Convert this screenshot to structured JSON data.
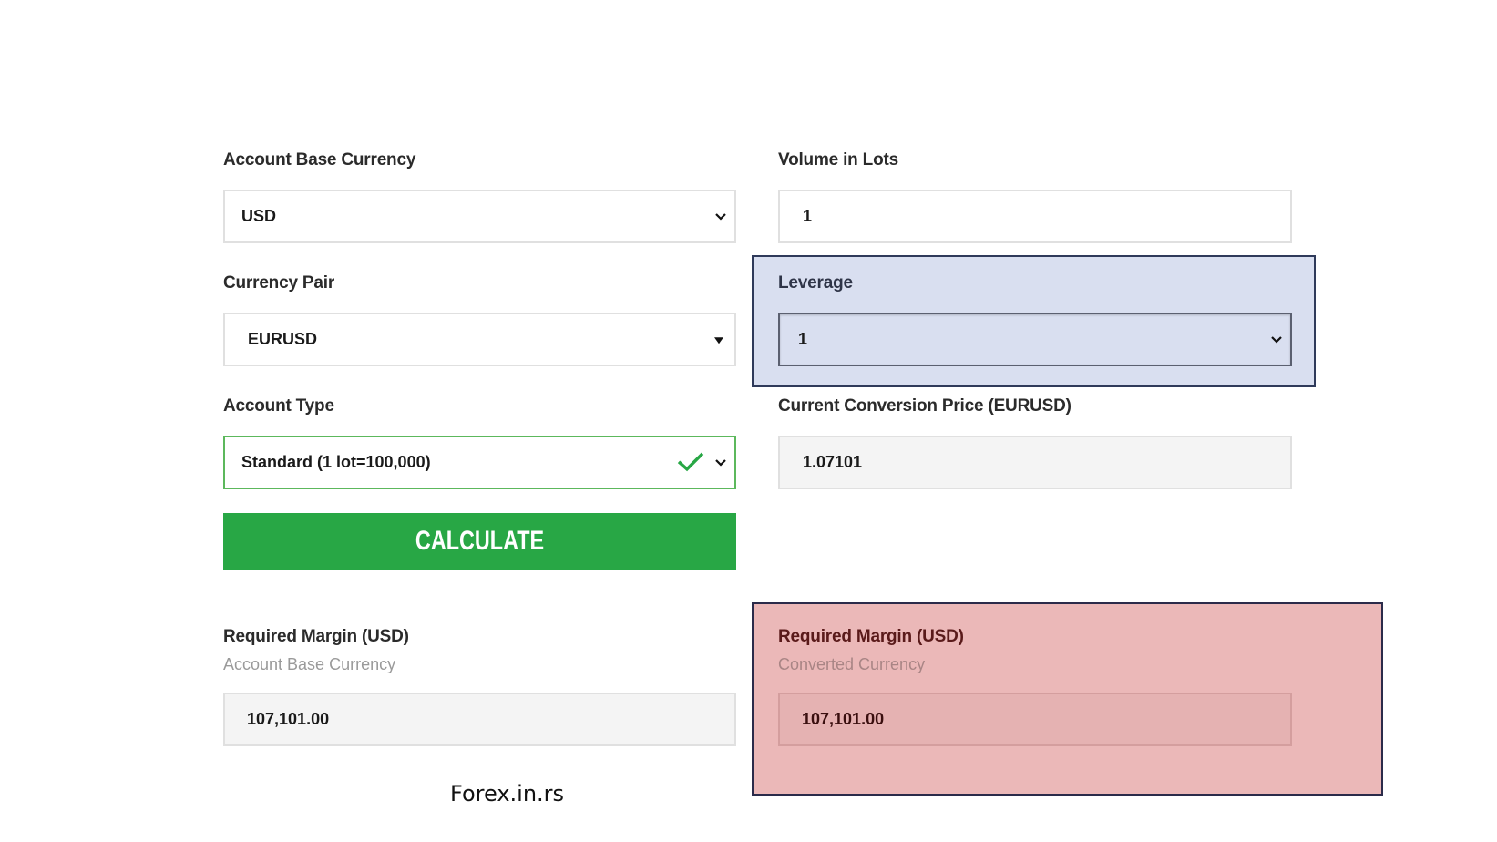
{
  "form": {
    "account_base_currency": {
      "label": "Account Base Currency",
      "value": "USD",
      "icon": "chevron-down-icon"
    },
    "volume_in_lots": {
      "label": "Volume in Lots",
      "value": "1"
    },
    "currency_pair": {
      "label": "Currency Pair",
      "value": "EURUSD",
      "icon": "caret-down-icon"
    },
    "leverage": {
      "label": "Leverage",
      "value": "1",
      "icon": "chevron-down-icon",
      "highlight_color": "#d9dff0"
    },
    "account_type": {
      "label": "Account Type",
      "value": "Standard (1 lot=100,000)",
      "valid_icon": "checkmark-icon",
      "icon": "chevron-down-icon",
      "valid_color": "#28a745"
    },
    "conversion_price": {
      "label": "Current Conversion Price (EURUSD)",
      "value": "1.07101"
    },
    "calculate_button": {
      "label": "CALCULATE",
      "color": "#28a745"
    }
  },
  "results": {
    "base_margin": {
      "label": "Required Margin (USD)",
      "sublabel": "Account Base Currency",
      "value": "107,101.00"
    },
    "converted_margin": {
      "label": "Required Margin (USD)",
      "sublabel": "Converted Currency",
      "value": "107,101.00",
      "highlight_color": "#ebb8b8"
    }
  },
  "footer": {
    "watermark": "Forex.in.rs"
  }
}
